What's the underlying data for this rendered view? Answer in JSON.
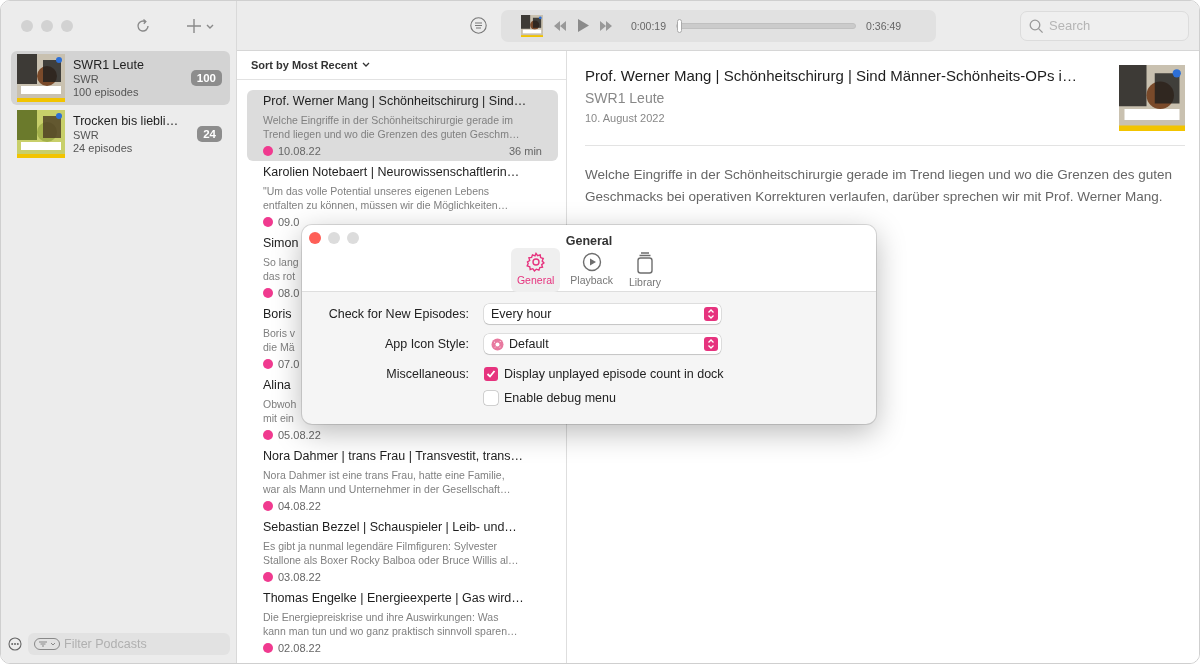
{
  "sidebar": {
    "podcasts": [
      {
        "name": "SWR1 Leute",
        "author": "SWR",
        "episodes": "100 episodes",
        "count": "100",
        "selected": true
      },
      {
        "name": "Trocken bis liebli…",
        "author": "SWR",
        "episodes": "24 episodes",
        "count": "24",
        "selected": false
      }
    ],
    "filter": {
      "placeholder": "Filter Podcasts"
    }
  },
  "player": {
    "elapsed": "0:00:19",
    "remaining": "0:36:49",
    "level": 0.01
  },
  "search": {
    "placeholder": "Search"
  },
  "episode_list": {
    "sort_label": "Sort by Most Recent",
    "episodes": [
      {
        "title": "Prof. Werner Mang | Schönheitschirurg | Sind…",
        "description_lines": [
          "Welche Eingriffe in der Schönheitschirurgie gerade im",
          "Trend liegen und wo die Grenzen des guten Geschm…"
        ],
        "date": "10.08.22",
        "duration": "36 min",
        "unplayed": true,
        "selected": true
      },
      {
        "title": "Karolien Notebaert | Neurowissenschaftlerin…",
        "description_lines": [
          "\"Um das volle Potential unseres eigenen Lebens",
          "entfalten zu können, müssen wir die Möglichkeiten…"
        ],
        "date": "09.0",
        "unplayed": true,
        "selected": false
      },
      {
        "title": "Simon",
        "description_lines": [
          "So lang",
          "das rot"
        ],
        "date": "08.0",
        "unplayed": true,
        "selected": false
      },
      {
        "title": "Boris",
        "description_lines": [
          "Boris v",
          "die Mä"
        ],
        "date": "07.0",
        "unplayed": true,
        "selected": false
      },
      {
        "title": "Alina",
        "description_lines": [
          "Obwoh",
          "mit ein"
        ],
        "date": "05.08.22",
        "unplayed": true,
        "selected": false
      },
      {
        "title": "Nora Dahmer | trans Frau | Transvestit, trans…",
        "description_lines": [
          "Nora Dahmer ist eine trans Frau, hatte eine Familie,",
          "war als Mann und Unternehmer in der Gesellschaft…"
        ],
        "date": "04.08.22",
        "unplayed": true,
        "selected": false
      },
      {
        "title": "Sebastian Bezzel | Schauspieler | Leib- und…",
        "description_lines": [
          "Es gibt ja nunmal legendäre Filmfiguren: Sylvester",
          "Stallone als Boxer Rocky Balboa oder Bruce Willis al…"
        ],
        "date": "03.08.22",
        "unplayed": true,
        "selected": false
      },
      {
        "title": "Thomas Engelke | Energieexperte | Gas wird…",
        "description_lines": [
          "Die Energiepreiskrise und ihre Auswirkungen: Was",
          "kann man tun und wo ganz praktisch sinnvoll sparen…"
        ],
        "date": "02.08.22",
        "unplayed": true,
        "selected": false
      }
    ]
  },
  "detail": {
    "title": "Prof. Werner Mang | Schönheitschirurg | Sind Männer-Schönheits-OPs i…",
    "podcast": "SWR1 Leute",
    "date": "10. August 2022",
    "description": "Welche Eingriffe in der Schönheitschirurgie gerade im Trend liegen und wo die Grenzen des guten Geschmacks bei operativen Korrekturen verlaufen, darüber sprechen wir mit Prof. Werner Mang."
  },
  "preferences_dialog": {
    "title": "General",
    "tabs": [
      {
        "label": "General",
        "kind": "general",
        "selected": true
      },
      {
        "label": "Playback",
        "kind": "playback",
        "selected": false
      },
      {
        "label": "Library",
        "kind": "library",
        "selected": false
      }
    ],
    "settings": [
      {
        "kind": "popup",
        "label": "Check for New Episodes:",
        "value": "Every hour"
      },
      {
        "kind": "icon-popup",
        "label": "App Icon Style:",
        "value": "Default"
      },
      {
        "kind": "checkboxes",
        "label": "Miscellaneous:",
        "options": [
          {
            "label": "Display unplayed episode count in dock",
            "checked": true
          },
          {
            "label": "Enable debug menu",
            "checked": false
          }
        ]
      }
    ]
  }
}
